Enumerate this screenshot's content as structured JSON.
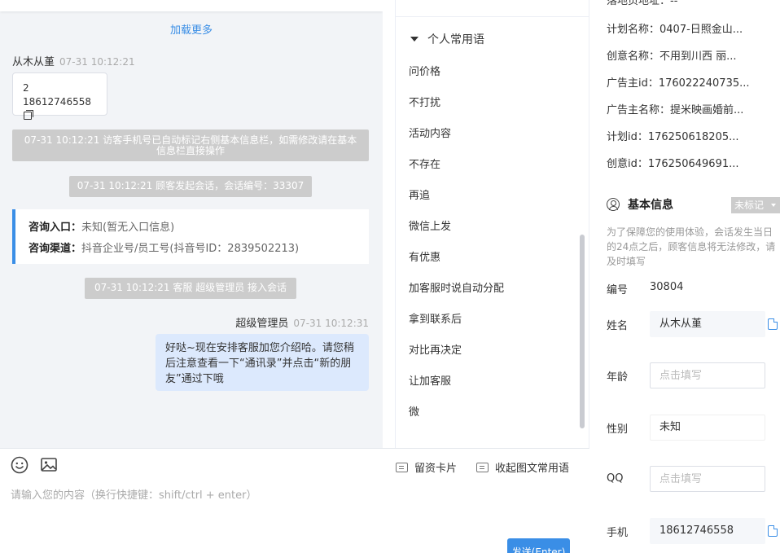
{
  "chat": {
    "load_more": "加载更多",
    "visitor_name": "从木从堇",
    "visitor_time": "07-31 10:12:21",
    "visitor_msg_line1": "2",
    "visitor_msg_line2": "18612746558",
    "sys_notice_1": "07-31 10:12:21 访客手机号已自动标记右侧基本信息栏，如需修改请在基本信息栏直接操作",
    "sys_notice_2": "07-31 10:12:21 顾客发起会话，会话编号：33307",
    "consult_entry_label": "咨询入口：",
    "consult_entry_value": "未知(暂无入口信息)",
    "consult_channel_label": "咨询渠道：",
    "consult_channel_value": "抖音企业号/员工号(抖音号ID：2839502213)",
    "sys_notice_3": "07-31 10:12:21 客服 超级管理员 接入会话",
    "agent_name": "超级管理员",
    "agent_time": "07-31 10:12:31",
    "agent_msg": "好哒~现在安排客服加您介绍哈。请您稍后注意查看一下“通讯录”并点击“新的朋友”通过下哦"
  },
  "composer": {
    "card_button": "留资卡片",
    "collapse_button": "收起图文常用语",
    "placeholder": "请输入您的内容（换行快捷键：shift/ctrl + enter）",
    "send_button": "发送(Enter)"
  },
  "phrases": {
    "group_label": "个人常用语",
    "items": [
      "问价格",
      "不打扰",
      "活动内容",
      "不存在",
      "再追",
      "微信上发",
      "有优惠",
      "加客服时说自动分配",
      "拿到联系后",
      "对比再决定",
      "让加客服",
      "微"
    ]
  },
  "info": {
    "landing_address": "落地页地址：--",
    "plan_name": "计划名称：0407-日照金山...",
    "creative_name": "创意名称：不用到川西 丽...",
    "advertiser_id": "广告主id：176022240735...",
    "advertiser_name": "广告主名称：提米映画婚前...",
    "plan_id": "计划id：176250618205...",
    "creative_id": "创意id：176250649691...",
    "basic_title": "基本信息",
    "mark_badge": "未标记",
    "basic_note": "为了保障您的使用体验，会话发生当日的24点之后，顾客信息将无法修改，请及时填写",
    "number_label": "编号",
    "number_value": "30804",
    "name_label": "姓名",
    "name_value": "从木从堇",
    "age_label": "年龄",
    "age_placeholder": "点击填写",
    "gender_label": "性别",
    "gender_value": "未知",
    "qq_label": "QQ",
    "qq_placeholder": "点击填写",
    "phone_label": "手机",
    "phone_value": "18612746558"
  },
  "colors": {
    "accent": "#3a8ee6",
    "agent_bubble": "#dce9fd",
    "notice_gray": "#cccccc",
    "chat_bg": "#f2f4f7"
  }
}
